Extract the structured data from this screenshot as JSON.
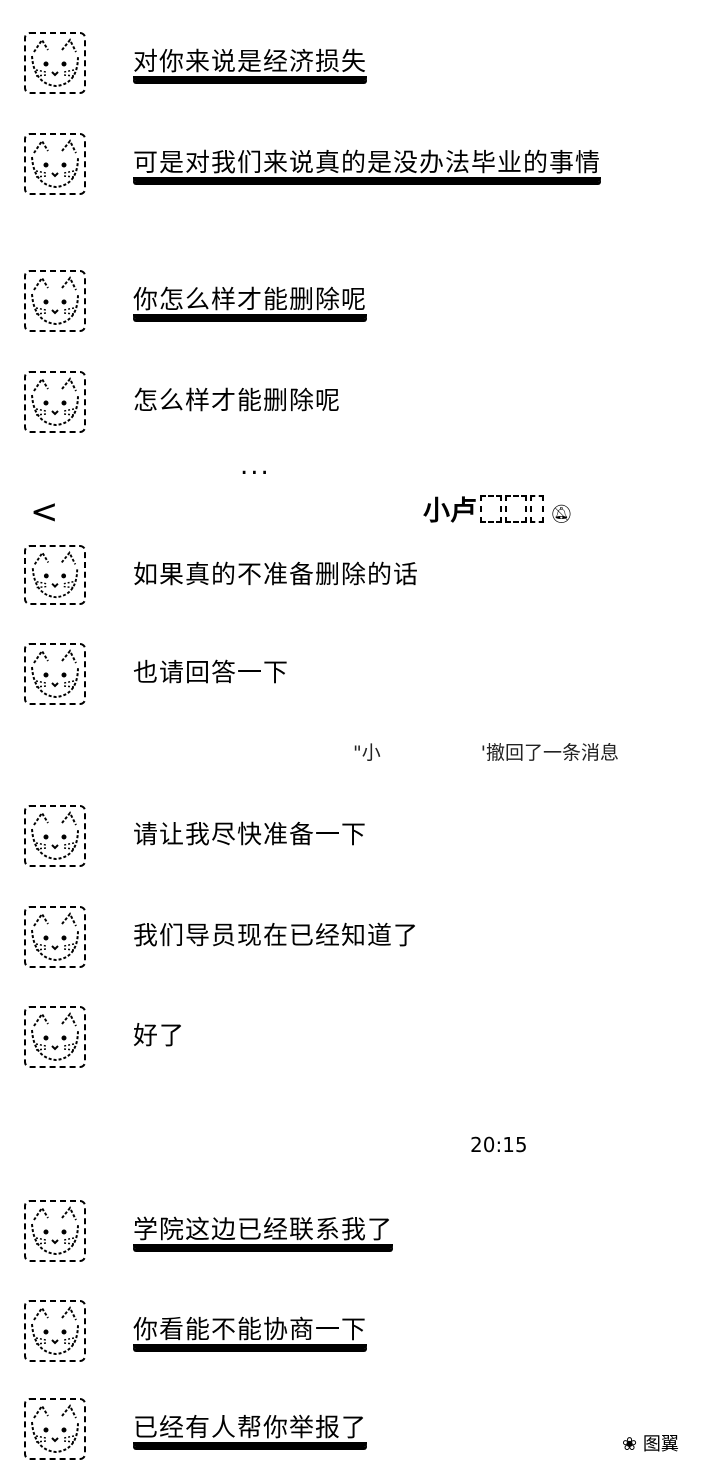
{
  "header": {
    "back_label": "<",
    "title": "小卢",
    "mute_icon": "bell-off-icon"
  },
  "more_dots": "...",
  "messages_top": [
    {
      "text": "对你来说是经济损失"
    },
    {
      "text": "可是对我们来说真的是没办法毕业的事情"
    },
    {
      "text": "你怎么样才能删除呢"
    },
    {
      "text": "怎么样才能删除呢"
    }
  ],
  "messages_middle": [
    {
      "text": "如果真的不准备删除的话"
    },
    {
      "text": "也请回答一下"
    }
  ],
  "recall_notice": {
    "prefix": "\"小",
    "suffix": "'撤回了一条消息"
  },
  "messages_lower": [
    {
      "text": "请让我尽快准备一下"
    },
    {
      "text": "我们导员现在已经知道了"
    },
    {
      "text": "好了"
    }
  ],
  "timestamp": "20:15",
  "messages_bottom": [
    {
      "text": "学院这边已经联系我了"
    },
    {
      "text": "你看能不能协商一下"
    },
    {
      "text": "已经有人帮你举报了"
    }
  ],
  "watermark": "图翼",
  "colors": {
    "background": "#ffffff",
    "text": "#000000"
  }
}
